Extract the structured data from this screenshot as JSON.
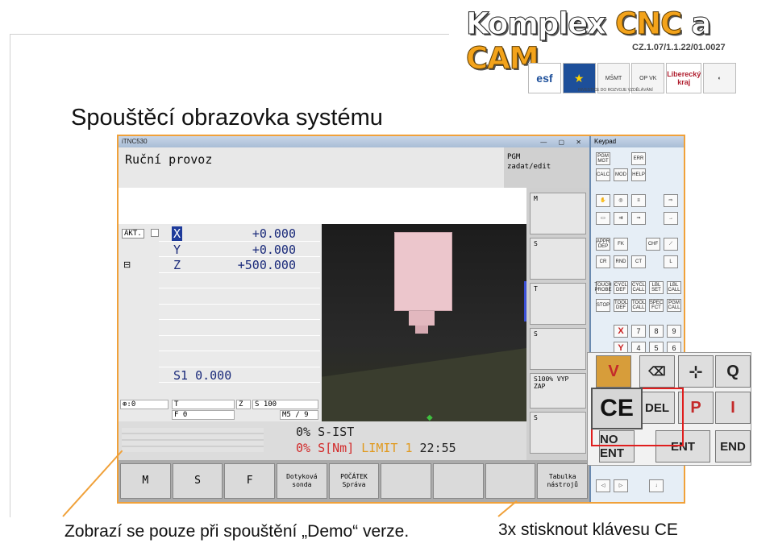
{
  "header": {
    "logo_part1": "Komplex ",
    "logo_part2": "CNC",
    "logo_part3": " a ",
    "logo_part4": "CAM",
    "project_code": "CZ.1.07/1.1.22/01.0027",
    "partner_logos": [
      "esf",
      "EU",
      "MŠMT",
      "OP VK",
      "Liberecký kraj",
      "logo"
    ],
    "partner_caption": "INVESTICE DO ROZVOJE VZDĚLÁVÁNÍ"
  },
  "slide": {
    "title": "Spouštěcí obrazovka systému",
    "caption_left": "Zobrazí se pouze při spouštění „Demo“ verze.",
    "caption_right": "3x stisknout klávesu CE"
  },
  "tnc": {
    "window_title": "iTNC530",
    "window_buttons": "— ▢ ✕",
    "mode": "Ruční provoz",
    "pgm_line1": "PGM",
    "pgm_line2": "zadat/edit",
    "akt": "AKT.",
    "axes": [
      {
        "axis": "X",
        "value": "+0.000"
      },
      {
        "axis": "Y",
        "value": "+0.000"
      },
      {
        "axis": "Z",
        "value": "+500.000"
      }
    ],
    "spindle_line": "S1   0.000",
    "table": {
      "r1a": "⊕:0",
      "r1b": "T",
      "r1c": "Z",
      "r1d": "S 100",
      "r2b": "F 0",
      "r2d": "M5 / 9"
    },
    "status1": "0% S-IST",
    "status2_a": "0% S[Nm]",
    "status2_limit": "LIMIT 1",
    "status2_time": "22:55",
    "softkeys": [
      "M",
      "S",
      "F",
      "Dotyková sonda",
      "POČÁTEK Správa",
      "",
      "",
      "",
      "Tabulka nástrojů"
    ],
    "side": [
      "M",
      "S",
      "T",
      "S",
      "S100% VYP ZAP",
      "S"
    ]
  },
  "keypad": {
    "title": "Keypad",
    "keys": [
      "PGM MGT",
      "ERR",
      "CALC",
      "MOD",
      "HELP",
      "APPR DEP",
      "FK",
      "CHF",
      "CR",
      "RND",
      "CT",
      "L",
      "TOUCH PROBE",
      "CYCL DEF",
      "CYCL CALL",
      "LBL SET",
      "LBL CALL",
      "STOP",
      "TOOL DEF",
      "TOOL CALL",
      "SPEC FCT",
      "PGM CALL",
      "X",
      "7",
      "8",
      "9",
      "Y",
      "4",
      "5",
      "6"
    ]
  },
  "zoom": {
    "keys": [
      "V",
      "⌫",
      "⊹",
      "Q",
      "CE",
      "DEL",
      "P",
      "I",
      "NO ENT",
      "ENT",
      "END"
    ]
  }
}
